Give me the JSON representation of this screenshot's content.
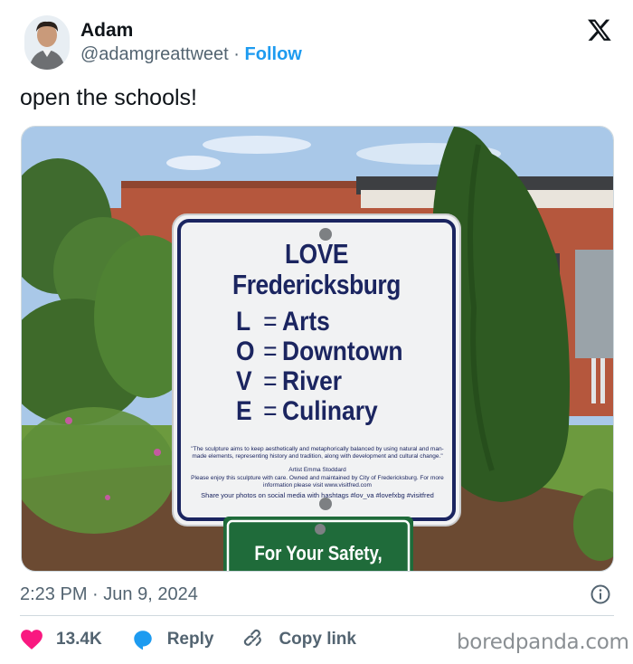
{
  "user": {
    "name": "Adam",
    "handle": "@adamgreattweet",
    "separator": "·",
    "follow_label": "Follow"
  },
  "platform_icon": "x-logo-icon",
  "tweet": {
    "text": "open the schools!"
  },
  "media": {
    "sign": {
      "line1": "LOVE",
      "line2": "Fredericksburg",
      "rows": [
        {
          "letter": "L",
          "eq": "=",
          "word": "Arts"
        },
        {
          "letter": "O",
          "eq": "=",
          "word": "Downtown"
        },
        {
          "letter": "V",
          "eq": "=",
          "word": "River"
        },
        {
          "letter": "E",
          "eq": "=",
          "word": "Culinary"
        }
      ],
      "fine_print_1": "\"The sculpture aims to keep aesthetically and metaphorically balanced by using natural and man-made elements, representing history and tradition, along with development and cultural change.\"",
      "fine_print_artist": "Artist Emma Stoddard",
      "fine_print_2": "Please enjoy this sculpture with care. Owned and maintained by City of Fredericksburg. For more information please visit www.visitfred.com",
      "share_text": "Share your photos on social media with hashtags #lov_va #lovefxbg #visitfred"
    },
    "safety_sign": "For Your Safety,",
    "colors": {
      "sign_blue": "#1b2560",
      "safety_green": "#1f6b3a",
      "sky": "#a9c8e8",
      "brick": "#b5573d"
    }
  },
  "meta": {
    "time": "2:23 PM",
    "separator": "·",
    "date": "Jun 9, 2024"
  },
  "actions": {
    "likes": "13.4K",
    "reply_label": "Reply",
    "copy_link_label": "Copy link"
  },
  "watermark": "boredpanda.com"
}
